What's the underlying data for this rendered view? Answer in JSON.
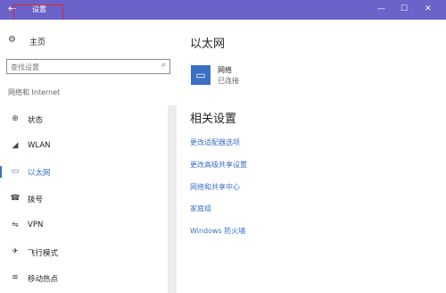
{
  "titlebar": {
    "back_icon": "back-arrow-icon",
    "title": "设置",
    "minimize_icon": "minimize-icon",
    "maximize_icon": "maximize-icon",
    "close_icon": "close-icon",
    "bg_color": "#6b63c9"
  },
  "sidebar": {
    "home_label": "主页",
    "home_icon": "gear-icon",
    "search_placeholder": "查找设置",
    "search_icon": "search-icon",
    "section_label": "网络和 Internet",
    "items": [
      {
        "label": "状态",
        "icon": "status-icon",
        "active": false
      },
      {
        "label": "WLAN",
        "icon": "wifi-icon",
        "active": false
      },
      {
        "label": "以太网",
        "icon": "ethernet-icon",
        "active": true
      },
      {
        "label": "拨号",
        "icon": "dialup-icon",
        "active": false
      },
      {
        "label": "VPN",
        "icon": "vpn-icon",
        "active": false
      },
      {
        "label": "飞行模式",
        "icon": "airplane-icon",
        "active": false
      },
      {
        "label": "移动热点",
        "icon": "hotspot-icon",
        "active": false
      }
    ]
  },
  "main": {
    "title": "以太网",
    "network": {
      "icon": "monitor-icon",
      "name": "网络",
      "status": "已连接"
    },
    "related_title": "相关设置",
    "related_links": [
      "更改适配器选项",
      "更改高级共享设置",
      "网络和共享中心",
      "家庭组",
      "Windows 防火墙"
    ]
  },
  "colors": {
    "accent": "#3a6fc4",
    "highlight_box": "#d9262b"
  }
}
